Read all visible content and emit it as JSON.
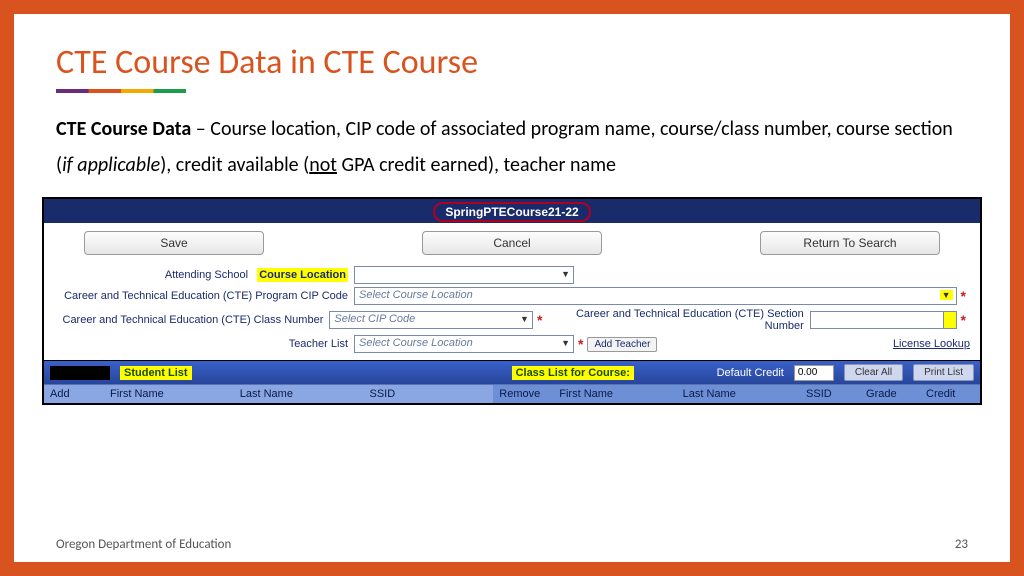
{
  "slide": {
    "title": "CTE Course Data in CTE Course",
    "desc_bold": "CTE Course Data",
    "desc_part1": " – Course location, CIP code of associated program name, course/class number, course section (",
    "desc_italic": "if applicable",
    "desc_part2": "), credit available (",
    "desc_underline": "not",
    "desc_part3": " GPA credit earned), teacher name"
  },
  "app": {
    "tab": "SpringPTECourse21-22",
    "buttons": {
      "save": "Save",
      "cancel": "Cancel",
      "return": "Return To Search"
    },
    "labels": {
      "attending": "Attending School",
      "course_location": "Course Location",
      "cip": "Career and Technical Education (CTE) Program CIP Code",
      "class_num": "Career and Technical Education (CTE) Class Number",
      "section_num": "Career and Technical Education (CTE) Section Number",
      "teacher": "Teacher List"
    },
    "selects": {
      "location_placeholder": "",
      "cip_placeholder": "Select Course Location",
      "class_placeholder": "Select CIP Code",
      "teacher_placeholder": "Select Course Location"
    },
    "add_teacher": "Add Teacher",
    "license_lookup": "License Lookup",
    "list_bar": {
      "student_list": "Student List",
      "class_list": "Class List for Course:",
      "default_credit_label": "Default Credit",
      "default_credit_value": "0.00",
      "clear_all": "Clear All",
      "print_list": "Print List"
    },
    "cols_left": {
      "add": "Add",
      "first": "First Name",
      "last": "Last Name",
      "ssid": "SSID"
    },
    "cols_right": {
      "remove": "Remove",
      "first": "First Name",
      "last": "Last Name",
      "ssid": "SSID",
      "grade": "Grade",
      "credit": "Credit"
    }
  },
  "footer": {
    "org": "Oregon Department of Education",
    "page": "23"
  }
}
